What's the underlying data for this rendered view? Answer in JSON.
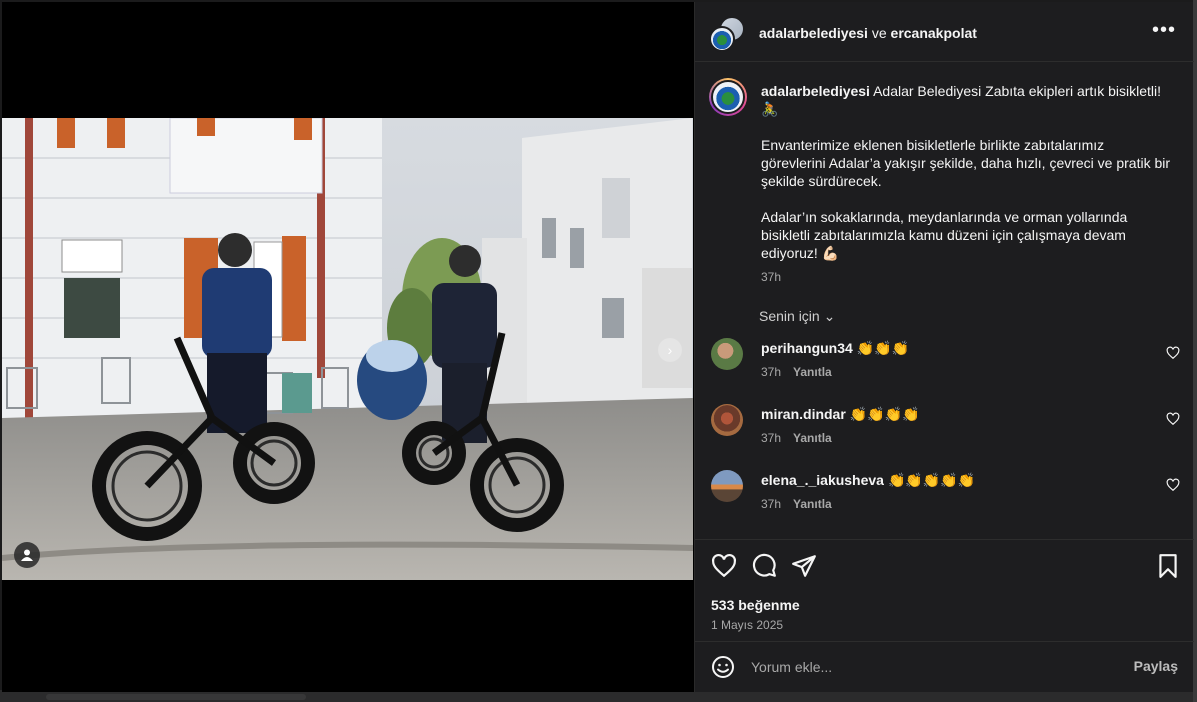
{
  "header": {
    "author": "adalarbelediyesi",
    "connector": "ve",
    "collaborator": "ercanakpolat",
    "more_label": "•••"
  },
  "caption": {
    "username": "adalarbelediyesi",
    "line1": "Adalar Belediyesi Zabıta ekipleri artık bisikletli! 🚴",
    "paragraph2": "Envanterimize eklenen bisikletlerle birlikte zabıtalarımız görevlerini Adalar’a yakışır şekilde, daha hızlı, çevreci ve pratik bir şekilde sürdürecek.",
    "paragraph3": "Adalar’ın sokaklarında, meydanlarında ve orman yollarında bisikletli zabıtalarımızla kamu düzeni için çalışmaya devam ediyoruz! 💪🏻",
    "time": "37h"
  },
  "for_you": {
    "label": "Senin için",
    "chevron": "⌄"
  },
  "comments": [
    {
      "username": "perihangun34",
      "text": "👏👏👏",
      "time": "37h",
      "reply": "Yanıtla"
    },
    {
      "username": "miran.dindar",
      "text": "👏👏👏👏",
      "time": "37h",
      "reply": "Yanıtla"
    },
    {
      "username": "elena_._iakusheva",
      "text": "👏👏👏👏👏",
      "time": "37h",
      "reply": "Yanıtla"
    }
  ],
  "actions": {
    "likes": "533 beğenme",
    "date": "1 Mayıs 2025"
  },
  "comment_bar": {
    "placeholder": "Yorum ekle...",
    "share_label": "Paylaş"
  },
  "icons": {
    "more": "more-icon",
    "like": "heart-icon",
    "comment": "comment-icon",
    "share": "send-icon",
    "save": "bookmark-icon",
    "emoji": "emoji-icon",
    "user_tag": "user-tag-icon"
  }
}
